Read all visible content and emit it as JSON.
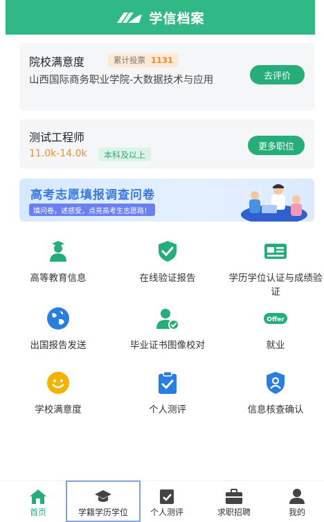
{
  "header": {
    "title": "学信档案",
    "logo_icon": "xuexin-logo-icon",
    "bg_color": "#30b886"
  },
  "satisfaction_card": {
    "title": "院校满意度",
    "vote_label": "累计投票",
    "vote_count": "1131",
    "school": "山西国际商务职业学院-大数据技术与应用",
    "button": "去评价"
  },
  "job_card": {
    "title": "测试工程师",
    "salary": "11.0k-14.0k",
    "education": "本科及以上",
    "button": "更多职位"
  },
  "banner": {
    "title": "高考志愿填报调查问卷",
    "subtitle": "填问卷，述感受，点亮高考生志愿路！"
  },
  "grid": [
    {
      "label": "高等教育信息",
      "icon": "graduate-person-icon"
    },
    {
      "label": "在线验证报告",
      "icon": "shield-check-icon"
    },
    {
      "label": "学历学位认证与成绩验证",
      "icon": "id-card-icon"
    },
    {
      "label": "出国报告发送",
      "icon": "globe-icon"
    },
    {
      "label": "毕业证书图像校对",
      "icon": "person-check-icon"
    },
    {
      "label": "就业",
      "icon": "offer-icon",
      "icon_text": "Offer"
    },
    {
      "label": "学校满意度",
      "icon": "smiley-icon"
    },
    {
      "label": "个人测评",
      "icon": "clipboard-check-icon"
    },
    {
      "label": "信息核查确认",
      "icon": "shield-user-icon"
    }
  ],
  "tabbar": [
    {
      "label": "首页",
      "icon": "home-icon",
      "active": true
    },
    {
      "label": "学籍学历学位",
      "icon": "graduation-cap-icon",
      "active": false
    },
    {
      "label": "个人测评",
      "icon": "clipboard-check-icon",
      "active": false
    },
    {
      "label": "求职招聘",
      "icon": "briefcase-icon",
      "active": false
    },
    {
      "label": "我的",
      "icon": "user-icon",
      "active": false
    }
  ],
  "colors": {
    "accent": "#26ad7a",
    "orange": "#f28a28",
    "blue": "#3a78e0"
  }
}
